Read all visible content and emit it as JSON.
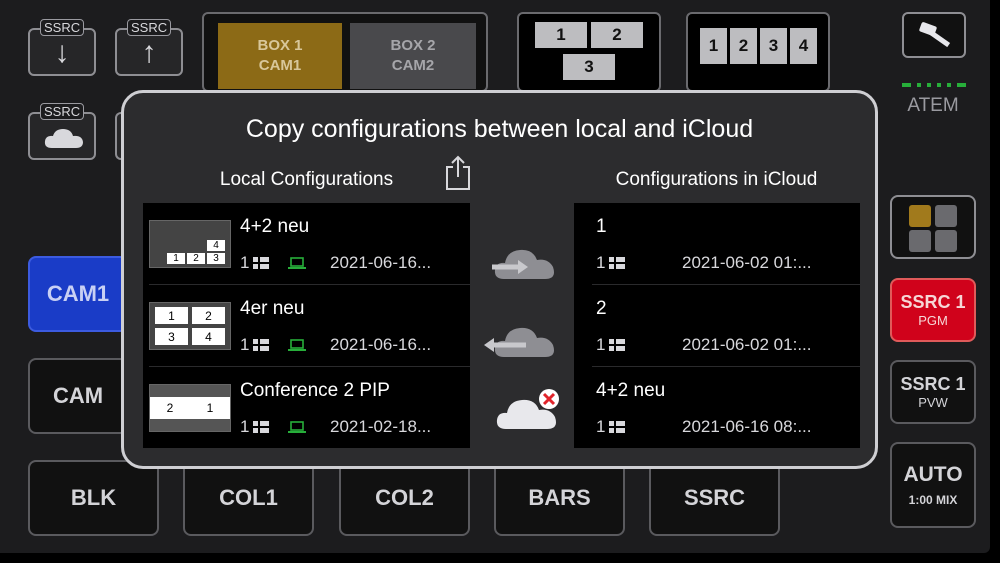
{
  "top_buttons": {
    "ssrc_tag": "SSRC",
    "box1_line1": "BOX 1",
    "box1_line2": "CAM1",
    "box2_line1": "BOX 2",
    "box2_line2": "CAM2",
    "layout3": [
      "1",
      "2",
      "3"
    ],
    "layout4": [
      "1",
      "2",
      "3",
      "4"
    ],
    "atem_label": "ATEM"
  },
  "left_buttons": {
    "cam1": "CAM1",
    "cam2": "CAM"
  },
  "bottom_buttons": [
    "BLK",
    "COL1",
    "COL2",
    "BARS",
    "SSRC"
  ],
  "right_buttons": {
    "ssrc_pgm_title": "SSRC 1",
    "ssrc_pgm_sub": "PGM",
    "ssrc_pvw_title": "SSRC 1",
    "ssrc_pvw_sub": "PVW",
    "auto_title": "AUTO",
    "auto_sub": "1:00 MIX"
  },
  "modal": {
    "title": "Copy configurations between local and iCloud",
    "local_header": "Local Configurations",
    "icloud_header": "Configurations in iCloud",
    "local_items": [
      {
        "name": "4+2 neu",
        "count": "1",
        "date": "2021-06-16...",
        "thumb": [
          "4",
          "1",
          "2",
          "3"
        ]
      },
      {
        "name": "4er neu",
        "count": "1",
        "date": "2021-06-16...",
        "thumb": [
          "1",
          "2",
          "3",
          "4"
        ]
      },
      {
        "name": "Conference 2 PIP",
        "count": "1",
        "date": "2021-02-18...",
        "thumb": [
          "2",
          "1"
        ]
      }
    ],
    "icloud_items": [
      {
        "name": "1",
        "count": "1",
        "date": "2021-06-02  01:..."
      },
      {
        "name": "2",
        "count": "1",
        "date": "2021-06-02  01:..."
      },
      {
        "name": "4+2 neu",
        "count": "1",
        "date": "2021-06-16  08:..."
      }
    ]
  },
  "colors": {
    "accent_green": "#27ae3a",
    "program_red": "#d0021b",
    "preview_blue": "#1a3cc7",
    "box1_amber": "#8c6a16",
    "delete_red": "#e0242b"
  }
}
